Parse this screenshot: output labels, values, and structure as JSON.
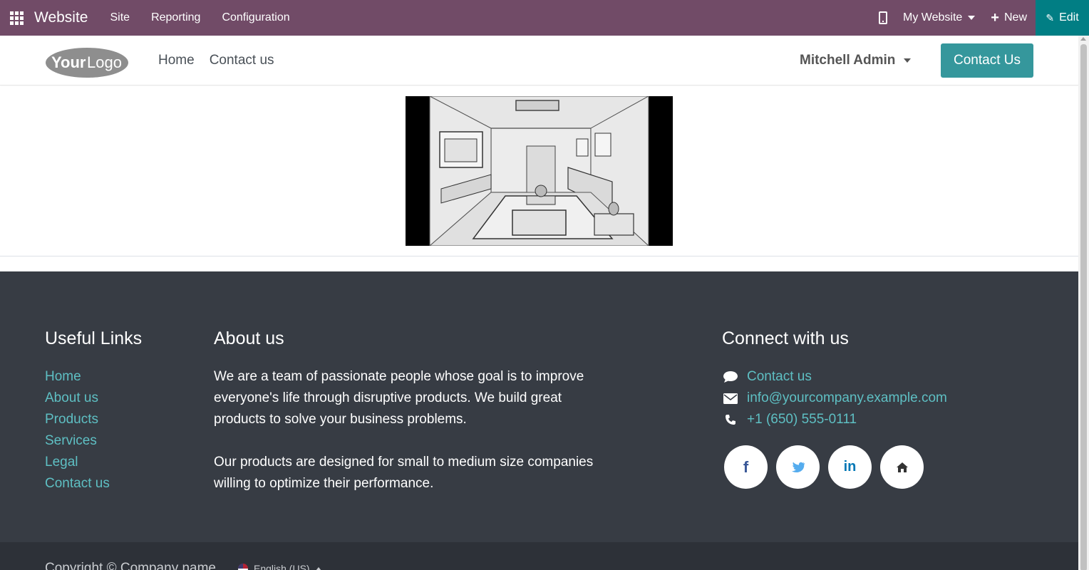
{
  "topbar": {
    "app_name": "Website",
    "menu": [
      "Site",
      "Reporting",
      "Configuration"
    ],
    "website_switch": "My Website",
    "new_label": "New",
    "edit_label": "Edit",
    "bg_color": "#714B67",
    "edit_color": "#017E84"
  },
  "header": {
    "logo_text": "YourLogo",
    "nav": [
      "Home",
      "Contact us"
    ],
    "user": "Mitchell Admin",
    "cta": "Contact Us",
    "cta_color": "#35979C"
  },
  "main": {
    "image": "living-room-sketch"
  },
  "footer": {
    "useful_links": {
      "title": "Useful Links",
      "links": [
        "Home",
        "About us",
        "Products",
        "Services",
        "Legal",
        "Contact us"
      ]
    },
    "about": {
      "title": "About us",
      "p1": "We are a team of passionate people whose goal is to improve everyone's life through disruptive products. We build great products to solve your business problems.",
      "p2": "Our products are designed for small to medium size companies willing to optimize their performance."
    },
    "connect": {
      "title": "Connect with us",
      "items": [
        {
          "icon": "comment-icon",
          "value": "Contact us"
        },
        {
          "icon": "envelope-icon",
          "value": "info@yourcompany.example.com"
        },
        {
          "icon": "phone-icon",
          "value": "+1 (650) 555-0111"
        }
      ],
      "socials": [
        {
          "icon": "facebook-icon",
          "glyph": "f",
          "color": "#3b5998"
        },
        {
          "icon": "twitter-icon",
          "glyph": "",
          "color": "#55acee"
        },
        {
          "icon": "linkedin-icon",
          "glyph": "in",
          "color": "#0077b5"
        },
        {
          "icon": "home-icon",
          "glyph": "",
          "color": "#333333"
        }
      ]
    },
    "bg_color": "#373C44",
    "link_color": "#5EBFC3"
  },
  "copyright": {
    "text": "Copyright © Company name",
    "language": "English (US)"
  }
}
